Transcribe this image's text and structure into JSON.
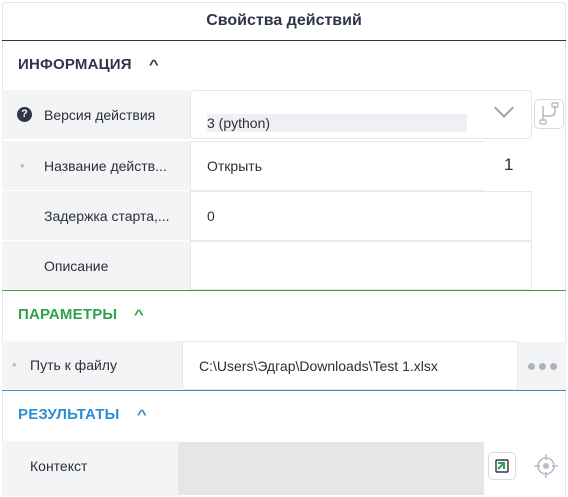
{
  "panel": {
    "title": "Свойства действий"
  },
  "sections": {
    "info": {
      "title": "ИНФОРМАЦИЯ",
      "chevron": "^"
    },
    "params": {
      "title": "ПАРАМЕТРЫ",
      "chevron": "^"
    },
    "results": {
      "title": "РЕЗУЛЬТАТЫ",
      "chevron": "^"
    }
  },
  "info": {
    "version": {
      "label": "Версия действия",
      "help_icon": "?",
      "value": "3 (python)"
    },
    "name": {
      "label": "Название действ...",
      "required": "*",
      "value": "Открыть",
      "counter": "1"
    },
    "delay": {
      "label": "Задержка старта,...",
      "value": "0"
    },
    "description": {
      "label": "Описание",
      "value": ""
    }
  },
  "params": {
    "path": {
      "label": "Путь к файлу",
      "required": "*",
      "value": "C:\\Users\\Эдгар\\Downloads\\Test 1.xlsx"
    }
  },
  "results": {
    "context": {
      "label": "Контекст",
      "value": ""
    }
  },
  "icons": {
    "help": "question-circle-icon",
    "select": "chevron-down-icon",
    "branch": "branch-icon",
    "more": "more-dots-icon",
    "insert": "insert-variable-icon",
    "target": "crosshair-icon"
  },
  "colors": {
    "header": "#2e3548",
    "params_accent": "#2fa24b",
    "results_accent": "#2a8fd6",
    "label_bg": "#f3f4f6",
    "context_bg": "#e5e6e8"
  }
}
